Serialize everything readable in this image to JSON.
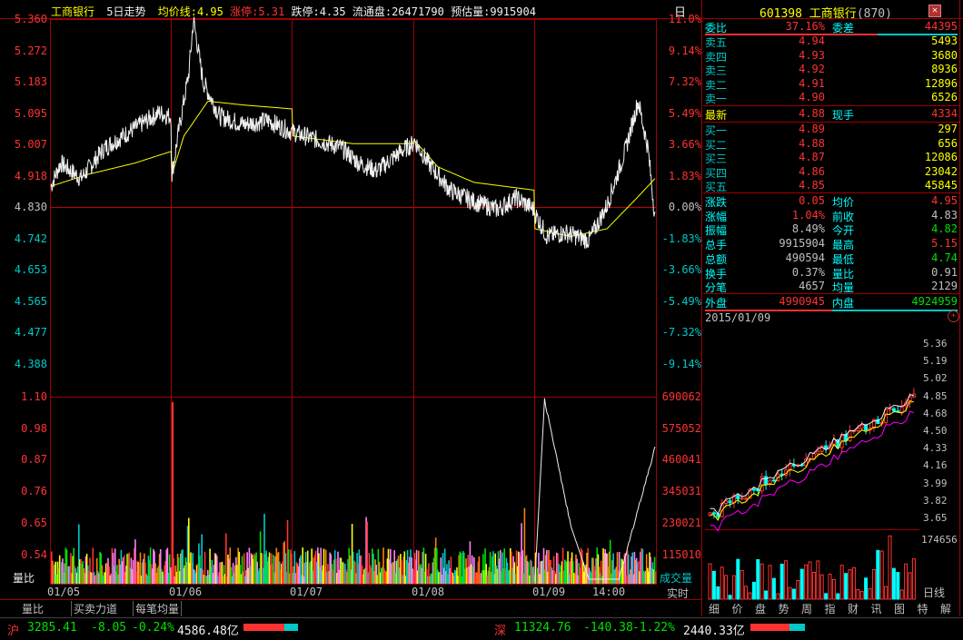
{
  "header": {
    "name": "工商银行",
    "period": "5日走势",
    "avg_label": "均价线:",
    "avg_value": "4.95",
    "limit_up_label": "涨停:",
    "limit_up_value": "5.31",
    "limit_down_label": "跌停:",
    "limit_down_value": "4.35",
    "float_label": "流通盘:",
    "float_value": "26471790",
    "est_vol_label": "预估量:",
    "est_vol_value": "9915904",
    "right_tag": "日"
  },
  "price_axis": {
    "left": [
      "5.360",
      "5.272",
      "5.183",
      "5.095",
      "5.007",
      "4.918",
      "4.830",
      "4.742",
      "4.653",
      "4.565",
      "4.477",
      "4.388"
    ],
    "right": [
      "11.0%",
      "9.14%",
      "7.32%",
      "5.49%",
      "3.66%",
      "1.83%",
      "0.00%",
      "-1.83%",
      "-3.66%",
      "-5.49%",
      "-7.32%",
      "-9.14%"
    ]
  },
  "volume_axis": {
    "left": [
      "1.10",
      "0.98",
      "0.87",
      "0.76",
      "0.65",
      "0.54"
    ],
    "right": [
      "690062",
      "575052",
      "460041",
      "345031",
      "230021",
      "115010"
    ],
    "left_caption": "量比",
    "right_caption": "成交量"
  },
  "x_labels": [
    "01/05",
    "01/06",
    "01/07",
    "01/08",
    "01/09",
    "14:00"
  ],
  "bottom_tabs": [
    "量比",
    "买卖力道",
    "每笔均量"
  ],
  "realtime_label": "实时",
  "quote": {
    "code": "601398",
    "name": "工商银行",
    "count": "(870)",
    "weibi_label": "委比",
    "weibi_value": "37.16%",
    "weicha_label": "委差",
    "weicha_value": "44395",
    "asks": [
      {
        "label": "卖五",
        "price": "4.94",
        "vol": "5493"
      },
      {
        "label": "卖四",
        "price": "4.93",
        "vol": "3680"
      },
      {
        "label": "卖三",
        "price": "4.92",
        "vol": "8936"
      },
      {
        "label": "卖二",
        "price": "4.91",
        "vol": "12896"
      },
      {
        "label": "卖一",
        "price": "4.90",
        "vol": "6526"
      }
    ],
    "latest_label": "最新",
    "latest_value": "4.88",
    "cur_vol_label": "现手",
    "cur_vol_value": "4334",
    "bids": [
      {
        "label": "买一",
        "price": "4.89",
        "vol": "297"
      },
      {
        "label": "买二",
        "price": "4.88",
        "vol": "656"
      },
      {
        "label": "买三",
        "price": "4.87",
        "vol": "12086"
      },
      {
        "label": "买四",
        "price": "4.86",
        "vol": "23042"
      },
      {
        "label": "买五",
        "price": "4.85",
        "vol": "45845"
      }
    ],
    "stats": [
      {
        "l1": "涨跌",
        "v1": "0.05",
        "l2": "均价",
        "v2": "4.95",
        "c1": "red",
        "c2": "red"
      },
      {
        "l1": "涨幅",
        "v1": "1.04%",
        "l2": "前收",
        "v2": "4.83",
        "c1": "red",
        "c2": "grey"
      },
      {
        "l1": "振幅",
        "v1": "8.49%",
        "l2": "今开",
        "v2": "4.82",
        "c1": "grey",
        "c2": "green"
      },
      {
        "l1": "总手",
        "v1": "9915904",
        "l2": "最高",
        "v2": "5.15",
        "c1": "grey",
        "c2": "red"
      },
      {
        "l1": "总额",
        "v1": "490594",
        "l2": "最低",
        "v2": "4.74",
        "c1": "grey",
        "c2": "green"
      },
      {
        "l1": "换手",
        "v1": "0.37%",
        "l2": "量比",
        "v2": "0.91",
        "c1": "grey",
        "c2": "grey"
      },
      {
        "l1": "分笔",
        "v1": "4657",
        "l2": "均量",
        "v2": "2129",
        "c1": "grey",
        "c2": "grey"
      }
    ],
    "outer_label": "外盘",
    "outer_value": "4990945",
    "inner_label": "内盘",
    "inner_value": "4924959"
  },
  "kline": {
    "date": "2015/01/09",
    "axis": [
      "5.36",
      "5.19",
      "5.02",
      "4.85",
      "4.68",
      "4.50",
      "4.33",
      "4.16",
      "3.99",
      "3.82",
      "3.65"
    ],
    "vol_label": "174656",
    "period_label": "日线"
  },
  "side_tabs": [
    "细",
    "价",
    "盘",
    "势",
    "周",
    "指",
    "财",
    "讯",
    "图",
    "特",
    "解"
  ],
  "status": {
    "sh_label": "沪",
    "sh_index": "3285.41",
    "sh_change": "-8.05",
    "sh_pct": "-0.24%",
    "sh_amount": "4586.48亿",
    "sz_label": "深",
    "sz_index": "11324.76",
    "sz_change": "-140.38",
    "sz_pct": "-1.22%",
    "sz_amount": "2440.33亿"
  },
  "colors": {
    "up": "#ff3232",
    "down": "#00e000",
    "avg": "#ffff00",
    "grid": "#a00000",
    "axis_cyan": "#00c8c8"
  },
  "chart_data": {
    "type": "line",
    "title": "工商银行 5日走势",
    "x": [
      "01/05",
      "01/06",
      "01/07",
      "01/08",
      "01/09"
    ],
    "series": [
      {
        "name": "price",
        "values": [
          4.96,
          5.07,
          5.05,
          4.93,
          4.88
        ]
      },
      {
        "name": "均价线",
        "values": [
          4.98,
          5.11,
          5.05,
          4.9,
          4.95
        ]
      }
    ],
    "ylim": [
      4.388,
      5.36
    ],
    "prev_close": 4.83
  }
}
